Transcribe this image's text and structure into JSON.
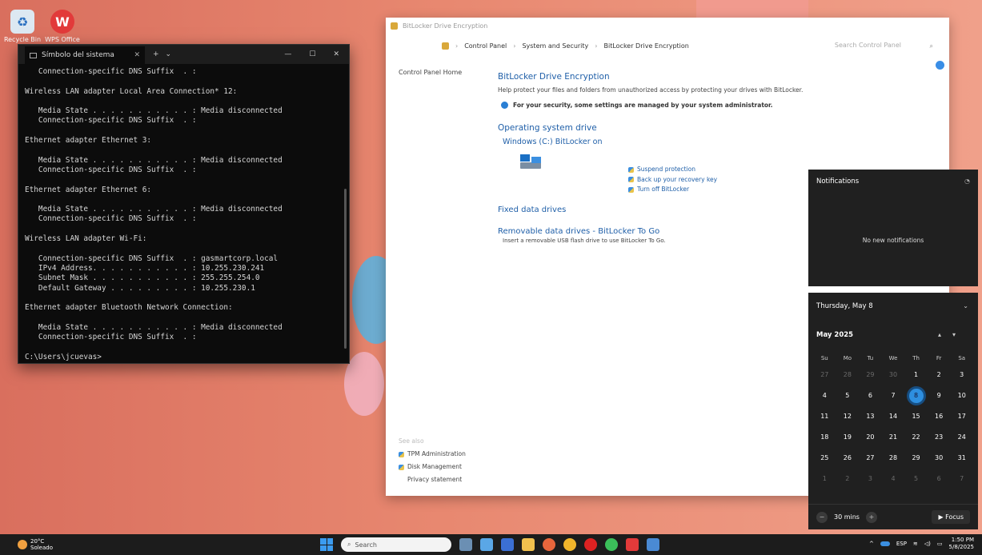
{
  "desktop": {
    "icons": [
      {
        "label": "Recycle Bin"
      },
      {
        "label": "WPS Office"
      }
    ]
  },
  "terminal": {
    "tab_title": "Símbolo del sistema",
    "lines": [
      "   Connection-specific DNS Suffix  . :",
      "",
      "Wireless LAN adapter Local Area Connection* 12:",
      "",
      "   Media State . . . . . . . . . . . : Media disconnected",
      "   Connection-specific DNS Suffix  . :",
      "",
      "Ethernet adapter Ethernet 3:",
      "",
      "   Media State . . . . . . . . . . . : Media disconnected",
      "   Connection-specific DNS Suffix  . :",
      "",
      "Ethernet adapter Ethernet 6:",
      "",
      "   Media State . . . . . . . . . . . : Media disconnected",
      "   Connection-specific DNS Suffix  . :",
      "",
      "Wireless LAN adapter Wi-Fi:",
      "",
      "   Connection-specific DNS Suffix  . : gasmartcorp.local",
      "   IPv4 Address. . . . . . . . . . . : 10.255.230.241",
      "   Subnet Mask . . . . . . . . . . . : 255.255.254.0",
      "   Default Gateway . . . . . . . . . : 10.255.230.1",
      "",
      "Ethernet adapter Bluetooth Network Connection:",
      "",
      "   Media State . . . . . . . . . . . : Media disconnected",
      "   Connection-specific DNS Suffix  . :",
      "",
      "C:\\Users\\jcuevas>"
    ]
  },
  "control_panel": {
    "window_title": "BitLocker Drive Encryption",
    "breadcrumb": [
      "Control Panel",
      "System and Security",
      "BitLocker Drive Encryption"
    ],
    "search_placeholder": "Search Control Panel",
    "side_home": "Control Panel Home",
    "heading": "BitLocker Drive Encryption",
    "description": "Help protect your files and folders from unauthorized access by protecting your drives with BitLocker.",
    "info_banner": "For your security, some settings are managed by your system administrator.",
    "os_drive_heading": "Operating system drive",
    "os_drive_label": "Windows (C:) BitLocker on",
    "actions": [
      "Suspend protection",
      "Back up your recovery key",
      "Turn off BitLocker"
    ],
    "fixed_heading": "Fixed data drives",
    "removable_heading": "Removable data drives - BitLocker To Go",
    "removable_hint": "Insert a removable USB flash drive to use BitLocker To Go.",
    "see_also_heading": "See also",
    "see_also": [
      "TPM Administration",
      "Disk Management",
      "Privacy statement"
    ]
  },
  "notifications": {
    "title": "Notifications",
    "empty": "No new notifications"
  },
  "calendar": {
    "date_header": "Thursday, May 8",
    "month": "May 2025",
    "weekdays": [
      "Su",
      "Mo",
      "Tu",
      "We",
      "Th",
      "Fr",
      "Sa"
    ],
    "days": [
      {
        "n": "27",
        "dim": true
      },
      {
        "n": "28",
        "dim": true
      },
      {
        "n": "29",
        "dim": true
      },
      {
        "n": "30",
        "dim": true
      },
      {
        "n": "1"
      },
      {
        "n": "2"
      },
      {
        "n": "3"
      },
      {
        "n": "4"
      },
      {
        "n": "5"
      },
      {
        "n": "6"
      },
      {
        "n": "7"
      },
      {
        "n": "8",
        "today": true
      },
      {
        "n": "9"
      },
      {
        "n": "10"
      },
      {
        "n": "11"
      },
      {
        "n": "12"
      },
      {
        "n": "13"
      },
      {
        "n": "14"
      },
      {
        "n": "15"
      },
      {
        "n": "16"
      },
      {
        "n": "17"
      },
      {
        "n": "18"
      },
      {
        "n": "19"
      },
      {
        "n": "20"
      },
      {
        "n": "21"
      },
      {
        "n": "22"
      },
      {
        "n": "23"
      },
      {
        "n": "24"
      },
      {
        "n": "25"
      },
      {
        "n": "26"
      },
      {
        "n": "27"
      },
      {
        "n": "28"
      },
      {
        "n": "29"
      },
      {
        "n": "30"
      },
      {
        "n": "31"
      },
      {
        "n": "1",
        "dim": true
      },
      {
        "n": "2",
        "dim": true
      },
      {
        "n": "3",
        "dim": true
      },
      {
        "n": "4",
        "dim": true
      },
      {
        "n": "5",
        "dim": true
      },
      {
        "n": "6",
        "dim": true
      },
      {
        "n": "7",
        "dim": true
      }
    ],
    "focus_minutes": "30 mins",
    "focus_label": "Focus"
  },
  "taskbar": {
    "weather_temp": "20°C",
    "weather_desc": "Soleado",
    "search_placeholder": "Search",
    "language": "ESP",
    "time": "1:50 PM",
    "date": "5/8/2025"
  }
}
